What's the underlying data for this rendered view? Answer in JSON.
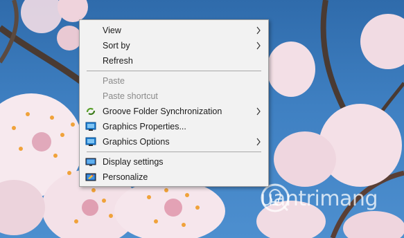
{
  "context_menu": {
    "items": [
      {
        "label": "View",
        "icon": "",
        "submenu": true,
        "disabled": false
      },
      {
        "label": "Sort by",
        "icon": "",
        "submenu": true,
        "disabled": false
      },
      {
        "label": "Refresh",
        "icon": "",
        "submenu": false,
        "disabled": false
      },
      {
        "label": "Paste",
        "icon": "",
        "submenu": false,
        "disabled": true
      },
      {
        "label": "Paste shortcut",
        "icon": "",
        "submenu": false,
        "disabled": true
      },
      {
        "label": "Groove Folder Synchronization",
        "icon": "groove-sync-icon",
        "submenu": true,
        "disabled": false
      },
      {
        "label": "Graphics Properties...",
        "icon": "intel-graphics-icon",
        "submenu": false,
        "disabled": false
      },
      {
        "label": "Graphics Options",
        "icon": "intel-graphics-icon",
        "submenu": true,
        "disabled": false
      },
      {
        "label": "Display settings",
        "icon": "display-icon",
        "submenu": false,
        "disabled": false
      },
      {
        "label": "Personalize",
        "icon": "personalize-icon",
        "submenu": false,
        "disabled": false
      }
    ]
  },
  "watermark": {
    "text": "uantrimang",
    "logo": "quantrimang-bulb-logo"
  },
  "colors": {
    "menu_bg": "#f2f2f2",
    "disabled_text": "#8a8a8a",
    "sky": "#3f80c2",
    "blossom": "#f6e6ec"
  }
}
